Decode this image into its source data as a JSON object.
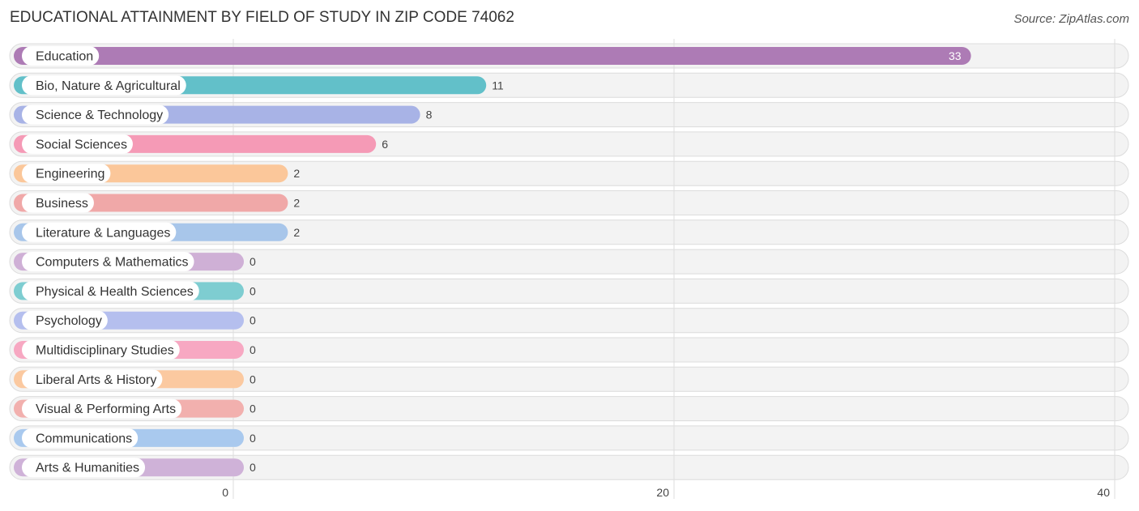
{
  "header": {
    "title": "EDUCATIONAL ATTAINMENT BY FIELD OF STUDY IN ZIP CODE 74062",
    "source": "Source: ZipAtlas.com"
  },
  "chart_data": {
    "type": "bar",
    "orientation": "horizontal",
    "title": "EDUCATIONAL ATTAINMENT BY FIELD OF STUDY IN ZIP CODE 74062",
    "xlabel": "",
    "ylabel": "",
    "xlim": [
      0,
      40
    ],
    "xticks": [
      0,
      20,
      40
    ],
    "grid": true,
    "categories": [
      "Education",
      "Bio, Nature & Agricultural",
      "Science & Technology",
      "Social Sciences",
      "Engineering",
      "Business",
      "Literature & Languages",
      "Computers & Mathematics",
      "Physical & Health Sciences",
      "Psychology",
      "Multidisciplinary Studies",
      "Liberal Arts & History",
      "Visual & Performing Arts",
      "Communications",
      "Arts & Humanities"
    ],
    "values": [
      33,
      11,
      8,
      6,
      2,
      2,
      2,
      0,
      0,
      0,
      0,
      0,
      0,
      0,
      0
    ],
    "colors": [
      "#ad7bb5",
      "#62c0c9",
      "#a8b3e6",
      "#f59ab6",
      "#fbc79a",
      "#f0a8a8",
      "#a8c6ea",
      "#cfb0d6",
      "#7ecdd1",
      "#b5bfee",
      "#f7a8c2",
      "#fbc9a0",
      "#f2b0ae",
      "#a9c9ee",
      "#cfb2d8"
    ],
    "value_labels_inside": [
      true,
      false,
      false,
      false,
      false,
      false,
      false,
      false,
      false,
      false,
      false,
      false,
      false,
      false,
      false
    ]
  }
}
